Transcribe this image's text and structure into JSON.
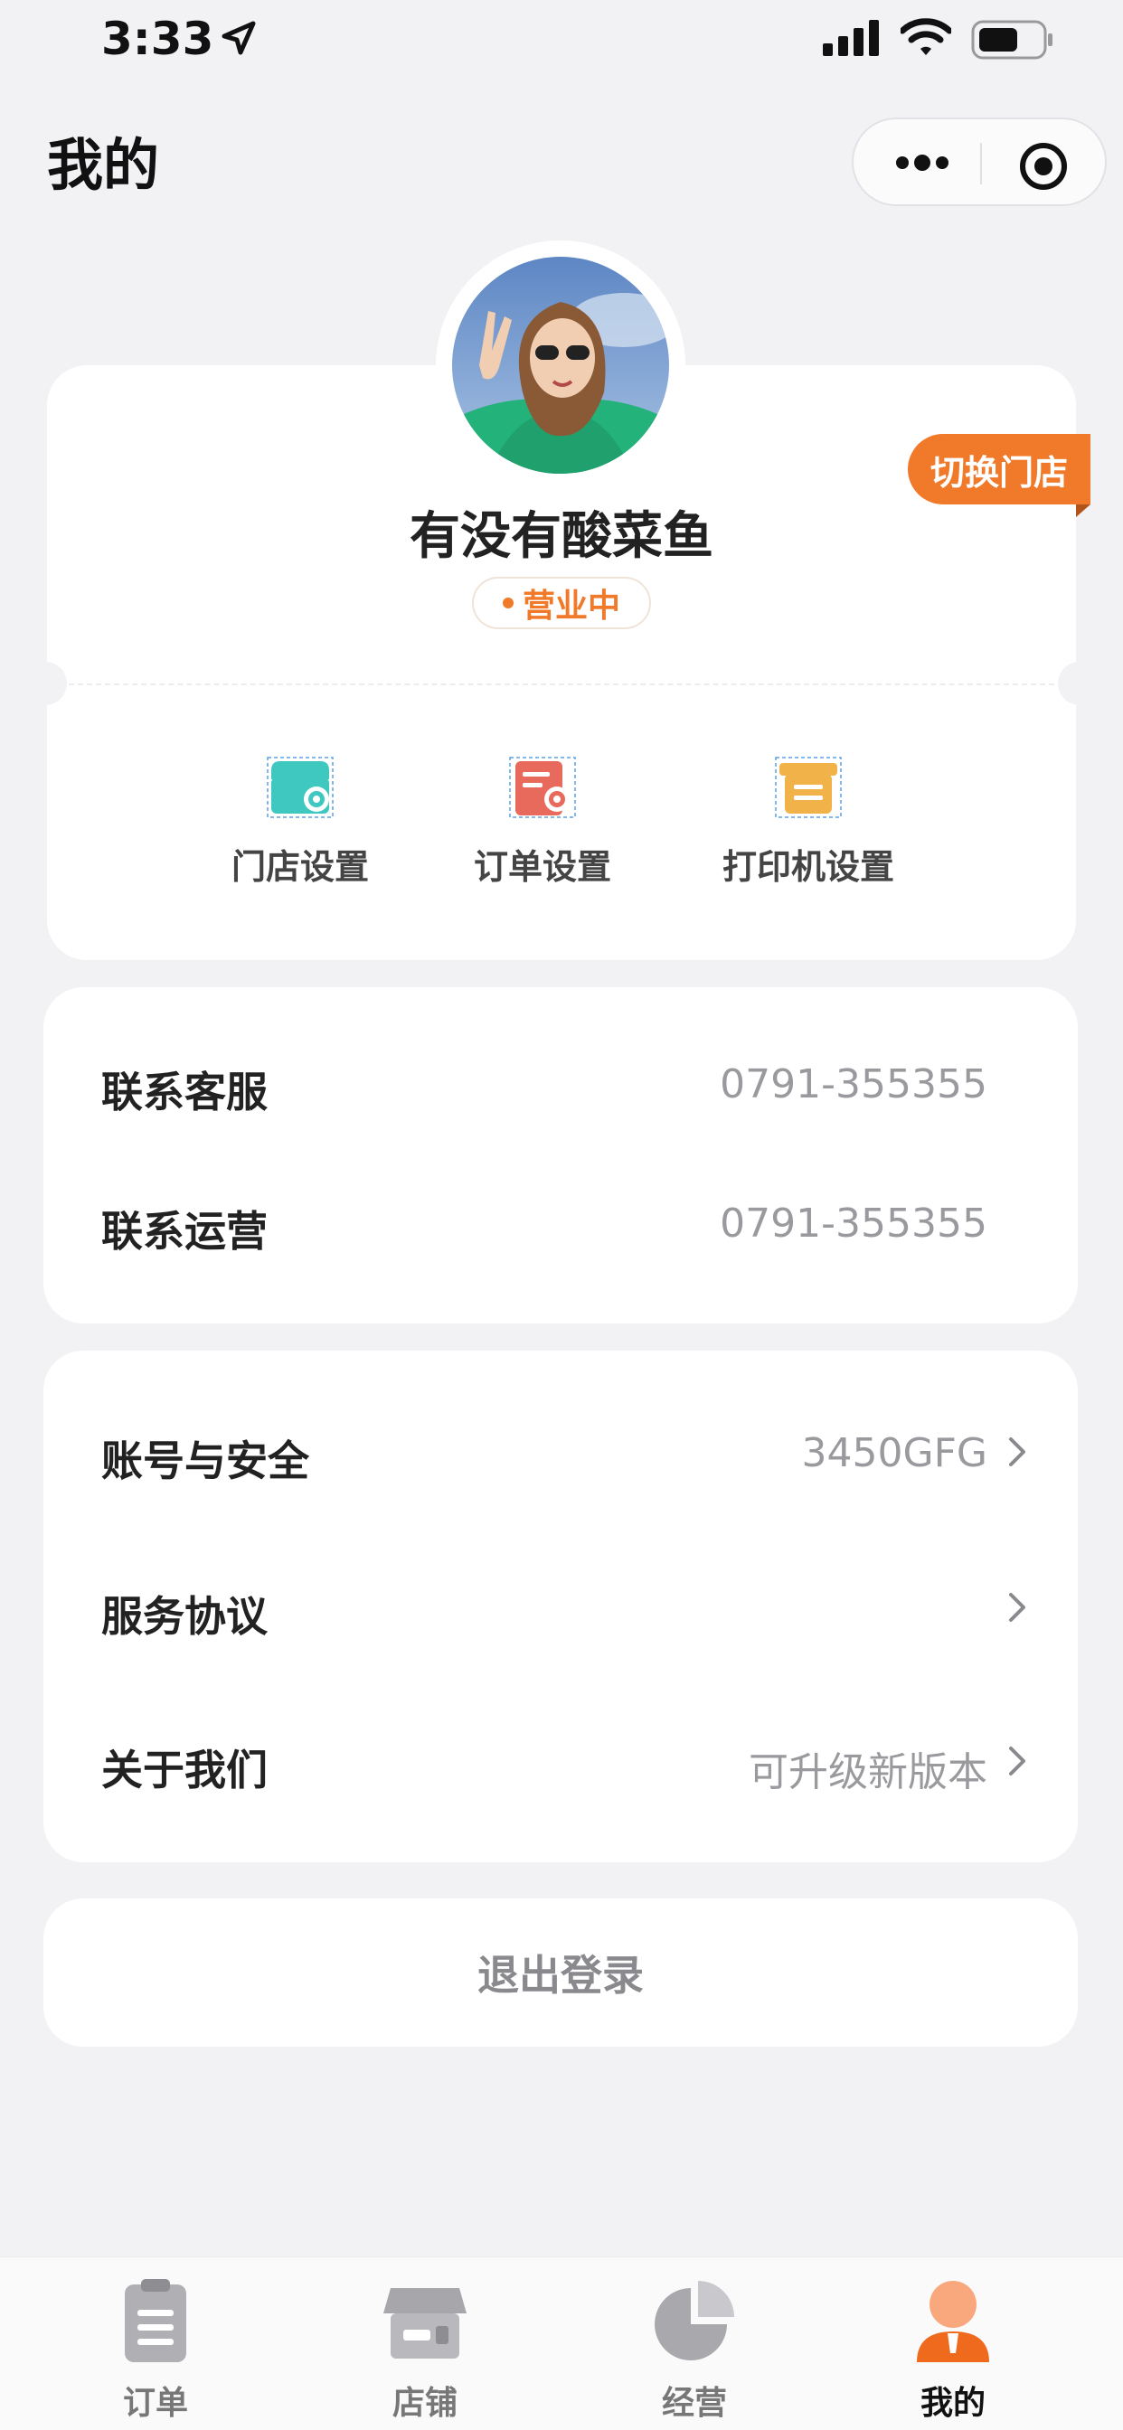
{
  "status_bar": {
    "time": "3:33"
  },
  "header": {
    "title": "我的"
  },
  "profile": {
    "switch_store_label": "切换门店",
    "store_name": "有没有酸菜鱼",
    "status": "营业中",
    "shortcuts": [
      {
        "label": "门店设置",
        "icon": "store-settings-icon",
        "color": "#3fc8c0"
      },
      {
        "label": "订单设置",
        "icon": "order-settings-icon",
        "color": "#e86a5c"
      },
      {
        "label": "打印机设置",
        "icon": "printer-settings-icon",
        "color": "#f2b24a"
      }
    ]
  },
  "contact": {
    "rows": [
      {
        "label": "联系客服",
        "value": "0791-355355"
      },
      {
        "label": "联系运营",
        "value": "0791-355355"
      }
    ]
  },
  "settings": {
    "rows": [
      {
        "label": "账号与安全",
        "value": "3450GFG"
      },
      {
        "label": "服务协议",
        "value": ""
      },
      {
        "label": "关于我们",
        "value": "可升级新版本"
      }
    ]
  },
  "logout_label": "退出登录",
  "tabbar": {
    "items": [
      {
        "label": "订单",
        "icon": "order-clipboard-icon"
      },
      {
        "label": "店铺",
        "icon": "shop-icon"
      },
      {
        "label": "经营",
        "icon": "pie-chart-icon"
      },
      {
        "label": "我的",
        "icon": "person-icon",
        "active": true
      }
    ]
  },
  "colors": {
    "accent": "#f07a2a",
    "background": "#f2f2f5"
  }
}
